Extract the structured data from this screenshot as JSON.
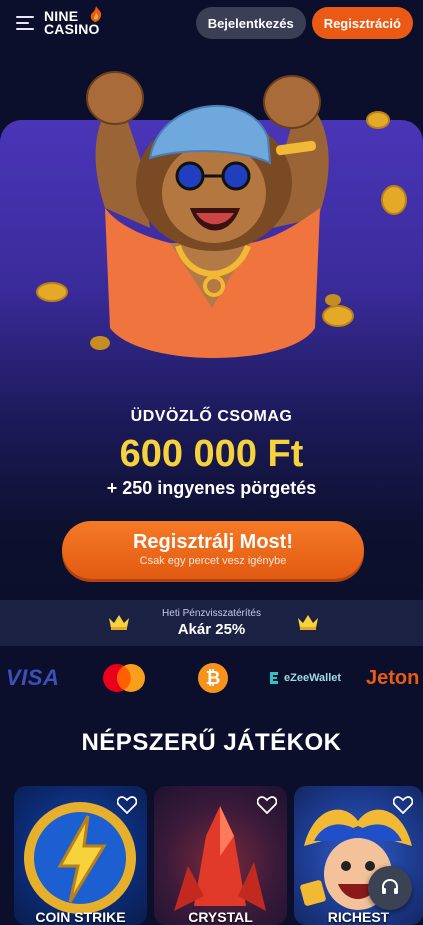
{
  "header": {
    "logo_line1": "NINE",
    "logo_line2": "CASINO",
    "login_label": "Bejelentkezés",
    "register_label": "Regisztráció",
    "menu_icon": "hamburger-menu-icon"
  },
  "hero": {
    "promo_title": "ÜDVÖZLŐ CSOMAG",
    "promo_amount": "600 000 Ft",
    "promo_spins": "+ 250 ingyenes pörgetés",
    "cta_label": "Regisztrálj Most!",
    "cta_sublabel": "Csak egy percet vesz igénybe",
    "colors": {
      "amount": "#f6d23c",
      "cta": "#ea5a14"
    }
  },
  "cashback": {
    "small_text": "Heti Pénzvisszatérítés",
    "big_text": "Akár 25%",
    "icon": "crown-icon"
  },
  "payments": {
    "visa": "VISA",
    "ezeewallet": "eZeeWallet",
    "jeton": "Jeton"
  },
  "games_section": {
    "title": "NÉPSZERŰ JÁTÉKOK",
    "games": [
      {
        "name": "COIN STRIKE"
      },
      {
        "name": "CRYSTAL"
      },
      {
        "name": "RICHEST"
      }
    ]
  },
  "support": {
    "icon": "headset-icon"
  }
}
